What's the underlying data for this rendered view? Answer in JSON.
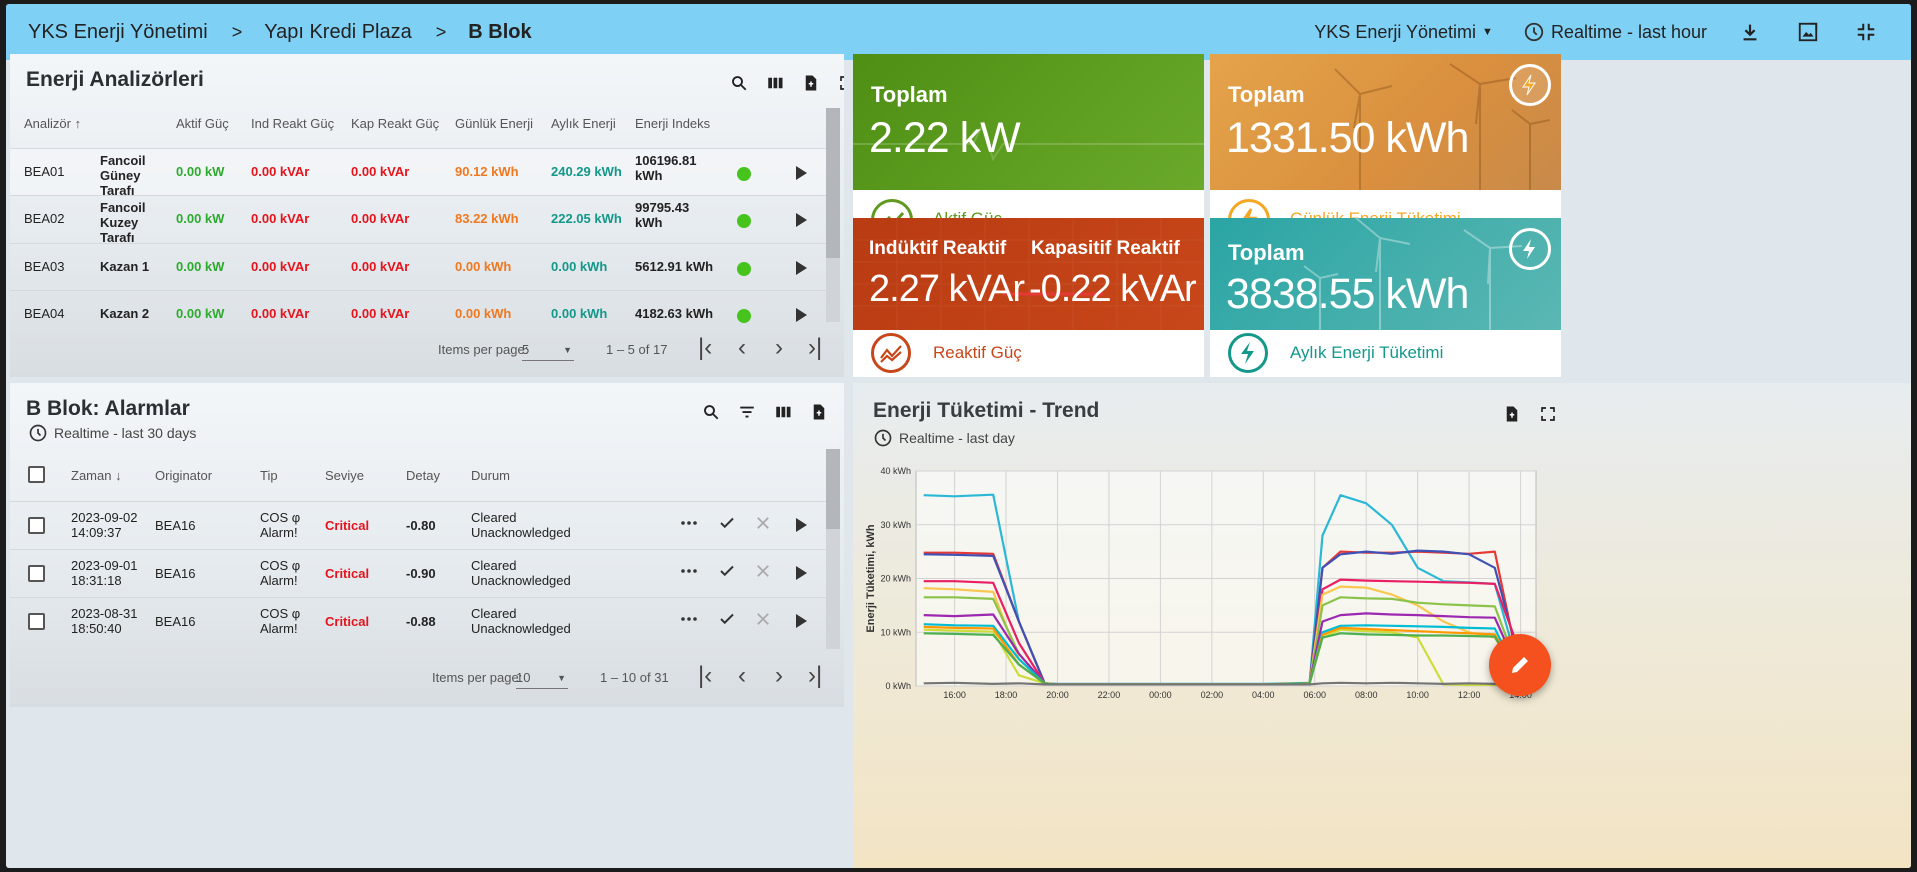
{
  "topbar": {
    "crumbs": [
      "YKS Enerji Yönetimi",
      "Yapı Kredi Plaza",
      "B Blok"
    ],
    "separator": ">",
    "dashboard_select": "YKS Enerji Yönetimi",
    "timewindow": "Realtime - last hour"
  },
  "analyzers": {
    "title": "Enerji Analizörleri",
    "columns": [
      "Analizör",
      "Aktif Güç",
      "Ind Reakt Güç",
      "Kap Reakt Güç",
      "Günlük Enerji",
      "Aylık Enerji",
      "Enerji Indeks"
    ],
    "rows": [
      {
        "id": "BEA01",
        "name": "Fancoil Güney Tarafı",
        "aktif": "0.00 kW",
        "ind": "0.00 kVAr",
        "kap": "0.00 kVAr",
        "gunluk": "90.12 kWh",
        "aylik": "240.29 kWh",
        "indeks": "106196.81 kWh"
      },
      {
        "id": "BEA02",
        "name": "Fancoil Kuzey Tarafı",
        "aktif": "0.00 kW",
        "ind": "0.00 kVAr",
        "kap": "0.00 kVAr",
        "gunluk": "83.22 kWh",
        "aylik": "222.05 kWh",
        "indeks": "99795.43 kWh"
      },
      {
        "id": "BEA03",
        "name": "Kazan 1",
        "aktif": "0.00 kW",
        "ind": "0.00 kVAr",
        "kap": "0.00 kVAr",
        "gunluk": "0.00 kWh",
        "aylik": "0.00 kWh",
        "indeks": "5612.91 kWh"
      },
      {
        "id": "BEA04",
        "name": "Kazan 2",
        "aktif": "0.00 kW",
        "ind": "0.00 kVAr",
        "kap": "0.00 kVAr",
        "gunluk": "0.00 kWh",
        "aylik": "0.00 kWh",
        "indeks": "4182.63 kWh"
      }
    ],
    "items_per_page_label": "Items per page:",
    "items_per_page": "5",
    "range": "1 – 5 of 17"
  },
  "alarms": {
    "title": "B Blok: Alarmlar",
    "timewindow": "Realtime - last 30 days",
    "columns": [
      "Zaman",
      "Originator",
      "Tip",
      "Seviye",
      "Detay",
      "Durum"
    ],
    "rows": [
      {
        "date": "2023-09-02",
        "time": "14:09:37",
        "orig": "BEA16",
        "tip1": "COS φ",
        "tip2": "Alarm!",
        "seviye": "Critical",
        "detay": "-0.80",
        "durum1": "Cleared",
        "durum2": "Unacknowledged"
      },
      {
        "date": "2023-09-01",
        "time": "18:31:18",
        "orig": "BEA16",
        "tip1": "COS φ",
        "tip2": "Alarm!",
        "seviye": "Critical",
        "detay": "-0.90",
        "durum1": "Cleared",
        "durum2": "Unacknowledged"
      },
      {
        "date": "2023-08-31",
        "time": "18:50:40",
        "orig": "BEA16",
        "tip1": "COS φ",
        "tip2": "Alarm!",
        "seviye": "Critical",
        "detay": "-0.88",
        "durum1": "Cleared",
        "durum2": "Unacknowledged"
      }
    ],
    "items_per_page_label": "Items per page:",
    "items_per_page": "10",
    "range": "1 – 10 of 31"
  },
  "cards": {
    "aktif": {
      "title": "Toplam",
      "value": "2.22 kW",
      "label": "Aktif Güç",
      "color": "#5f9a1f"
    },
    "gunluk": {
      "title": "Toplam",
      "value": "1331.50 kWh",
      "label": "Günlük Enerji Tüketimi",
      "color": "#f5a623"
    },
    "reaktif": {
      "title1": "Indüktif Reaktif",
      "value1": "2.27 kVAr",
      "title2": "Kapasitif Reaktif",
      "value2": "-0.22 kVAr",
      "label": "Reaktif Güç",
      "color": "#c8471a"
    },
    "aylik": {
      "title": "Toplam",
      "value": "3838.55 kWh",
      "label": "Aylık Enerji Tüketimi",
      "color": "#13988a"
    }
  },
  "trend": {
    "title": "Enerji Tüketimi - Trend",
    "timewindow": "Realtime - last day"
  },
  "chart_data": {
    "type": "line",
    "title": "",
    "xlabel": "",
    "ylabel": "Enerji Tüketimi, kWh",
    "ylim": [
      0,
      40
    ],
    "yticks": [
      "0 kWh",
      "10 kWh",
      "20 kWh",
      "30 kWh",
      "40 kWh"
    ],
    "xticks": [
      "16:00",
      "18:00",
      "20:00",
      "22:00",
      "00:00",
      "02:00",
      "04:00",
      "06:00",
      "08:00",
      "10:00",
      "12:00",
      "14:00"
    ],
    "x": [
      14.8,
      16.0,
      17.5,
      18.5,
      19.5,
      20.0,
      22.0,
      24.0,
      26.0,
      28.0,
      29.8,
      30.3,
      31.0,
      32.0,
      33.0,
      34.0,
      35.0,
      36.0,
      37.0,
      38.0
    ],
    "series": [
      {
        "color": "#2ab8d6",
        "values": [
          35.5,
          35.3,
          35.6,
          12,
          0.5,
          0.4,
          0.4,
          0.4,
          0.4,
          0.4,
          0.6,
          28,
          35.5,
          34,
          30,
          22,
          19.5,
          19.3,
          19,
          2
        ]
      },
      {
        "color": "#e53935",
        "values": [
          24.8,
          24.8,
          24.6,
          12,
          0.5,
          0.3,
          0.3,
          0.3,
          0.3,
          0.3,
          0.5,
          22,
          25,
          24.8,
          24.8,
          25,
          24.8,
          24.6,
          25,
          2
        ]
      },
      {
        "color": "#3f51b5",
        "values": [
          24.5,
          24.4,
          24.2,
          12,
          0.5,
          0.3,
          0.3,
          0.3,
          0.3,
          0.3,
          0.5,
          22,
          24.5,
          25,
          24.6,
          25.2,
          25,
          24.5,
          22,
          4
        ]
      },
      {
        "color": "#e91e63",
        "values": [
          19.5,
          19.5,
          19.2,
          8,
          0.5,
          0.3,
          0.3,
          0.3,
          0.3,
          0.3,
          0.5,
          18,
          19.8,
          19.6,
          19.5,
          19.4,
          19.3,
          19.2,
          19,
          6
        ]
      },
      {
        "color": "#f9c74f",
        "values": [
          18.2,
          18,
          17.5,
          5,
          0.5,
          0.3,
          0.3,
          0.3,
          0.3,
          0.3,
          0.5,
          17,
          18.5,
          18.3,
          17,
          15,
          12,
          10,
          9,
          1
        ]
      },
      {
        "color": "#8bc34a",
        "values": [
          16.5,
          16.5,
          16.2,
          6,
          0.5,
          0.3,
          0.3,
          0.3,
          0.3,
          0.3,
          0.5,
          15,
          16.5,
          16.3,
          16.2,
          15.5,
          15.2,
          15,
          14.8,
          2
        ]
      },
      {
        "color": "#9c27b0",
        "values": [
          13.2,
          13,
          13.3,
          6,
          0.5,
          0.3,
          0.3,
          0.3,
          0.3,
          0.3,
          0.5,
          12,
          13.2,
          13.5,
          13.3,
          13.2,
          13,
          12.8,
          12.7,
          2
        ]
      },
      {
        "color": "#00bcd4",
        "values": [
          11.5,
          11.3,
          11.2,
          5,
          0.5,
          0.3,
          0.3,
          0.3,
          0.3,
          0.3,
          0.5,
          10,
          11.2,
          11.3,
          11.2,
          11.1,
          11,
          10.8,
          10.7,
          1
        ]
      },
      {
        "color": "#cddc39",
        "values": [
          10.5,
          10.3,
          10.1,
          2,
          0.5,
          0.3,
          0.3,
          0.3,
          0.3,
          0.3,
          0.5,
          9,
          10.5,
          10.2,
          10,
          9,
          0.3,
          0.2,
          0.2,
          0.2
        ]
      },
      {
        "color": "#ff9800",
        "values": [
          11,
          10.8,
          10.7,
          4,
          0.5,
          0.3,
          0.3,
          0.3,
          0.3,
          0.3,
          0.5,
          9.5,
          10.8,
          10.6,
          10.4,
          10.2,
          10,
          9.8,
          9.6,
          1
        ]
      },
      {
        "color": "#4caf50",
        "values": [
          9.8,
          9.7,
          9.5,
          4,
          0.5,
          0.3,
          0.3,
          0.3,
          0.3,
          0.3,
          0.5,
          9,
          9.8,
          9.6,
          9.5,
          9.4,
          9.4,
          9.3,
          9.2,
          1
        ]
      },
      {
        "color": "#757575",
        "values": [
          0.5,
          0.6,
          0.4,
          0.5,
          0.3,
          0.3,
          0.3,
          0.3,
          0.3,
          0.3,
          0.3,
          0.5,
          0.6,
          0.5,
          0.6,
          0.5,
          0.4,
          0.5,
          0.4,
          0.5
        ]
      }
    ]
  }
}
